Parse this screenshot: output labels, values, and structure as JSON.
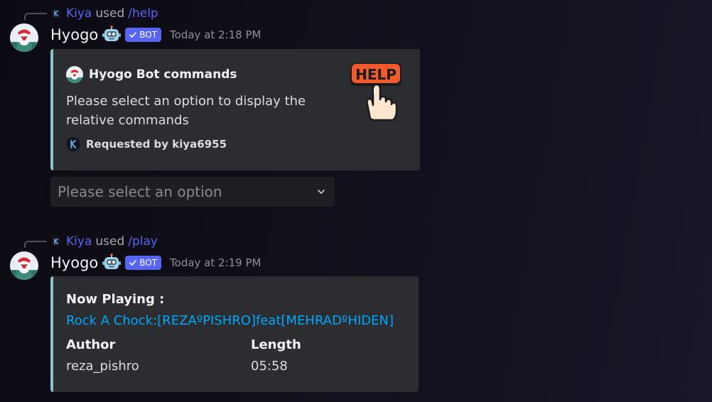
{
  "colors": {
    "accent": "#5865f2",
    "embed_border": "#8ac6c6",
    "link": "#00a8fc",
    "embed_bg": "#2b2d31"
  },
  "messages": [
    {
      "reply": {
        "avatar_icon": "kiya-avatar-icon",
        "user": "Kiya",
        "used": "used",
        "command": "/help"
      },
      "avatar_icon": "hyogo-avatar-icon",
      "username": "Hyogo",
      "emoji_icon": "robot-emoji-icon",
      "badge": "BOT",
      "timestamp": "Today at 2:18 PM",
      "embed": {
        "author_icon": "hyogo-avatar-icon",
        "author": "Hyogo Bot commands",
        "description": "Please select an option to display the relative commands",
        "footer_icon": "kiya-avatar-icon",
        "footer": "Requested by kiya6955",
        "thumbnail_text": "HELP"
      },
      "select": {
        "placeholder": "Please select an option",
        "icon": "chevron-down-icon"
      }
    },
    {
      "reply": {
        "avatar_icon": "kiya-avatar-icon",
        "user": "Kiya",
        "used": "used",
        "command": "/play"
      },
      "avatar_icon": "hyogo-avatar-icon",
      "username": "Hyogo",
      "emoji_icon": "robot-emoji-icon",
      "badge": "BOT",
      "timestamp": "Today at 2:19 PM",
      "embed": {
        "title": "Now Playing :",
        "track": "Rock A Chock:[REZAºPISHRO]feat[MEHRADºHIDEN]",
        "fields": [
          {
            "name": "Author",
            "value": "reza_pishro"
          },
          {
            "name": "Length",
            "value": "05:58"
          }
        ]
      }
    }
  ]
}
